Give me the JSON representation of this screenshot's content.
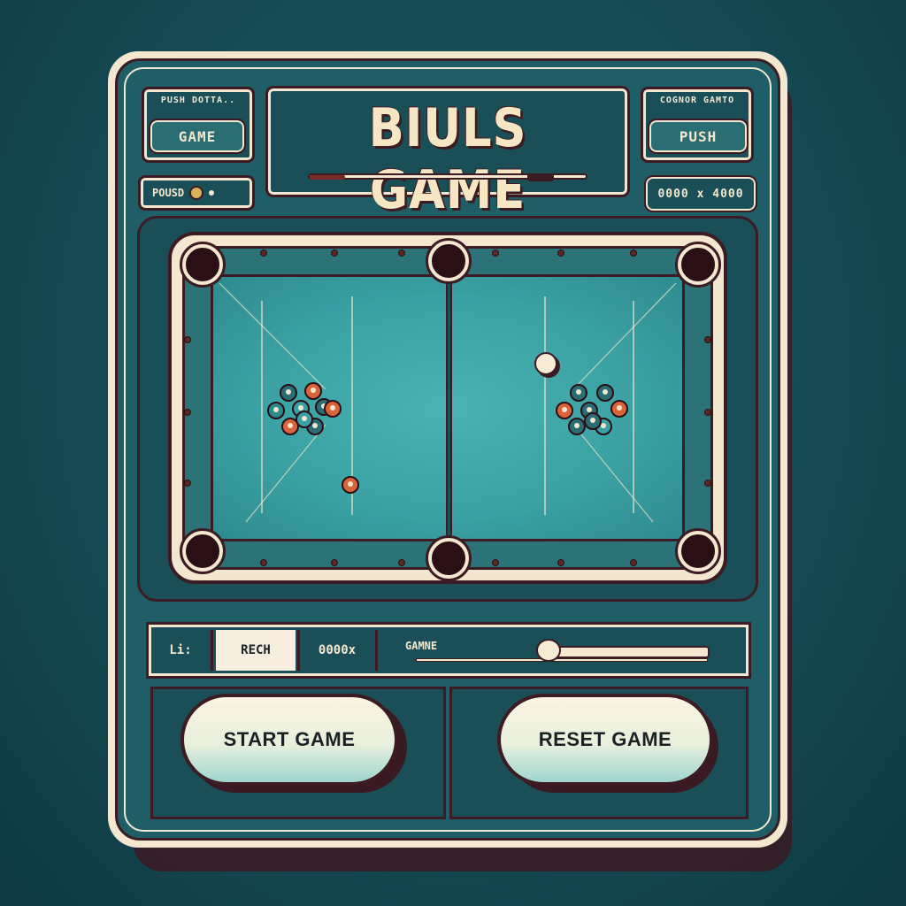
{
  "header": {
    "title": "BIULS GAME",
    "left_label": "PUSH DOTTA..",
    "left_button": "GAME",
    "left_power": "POUSD",
    "right_label": "COGNOR GAMTO",
    "right_button": "PUSH",
    "right_score": "0000 x 4000"
  },
  "status_bar": {
    "cell1": "Li:",
    "cell2": "RECH",
    "cell3": "0000x",
    "cell4": "GAMNE"
  },
  "buttons": {
    "start": "START GAME",
    "reset": "RESET GAME"
  },
  "colors": {
    "background": "#164a53",
    "cabinet_trim": "#f3e7cf",
    "felt": "#3aa0a3",
    "outline": "#3c1b22",
    "accent_orange": "#d9633a"
  },
  "balls": {
    "left_rack_count": 9,
    "right_rack_count": 8,
    "cue_ball": "white",
    "loose_ball": "orange"
  }
}
